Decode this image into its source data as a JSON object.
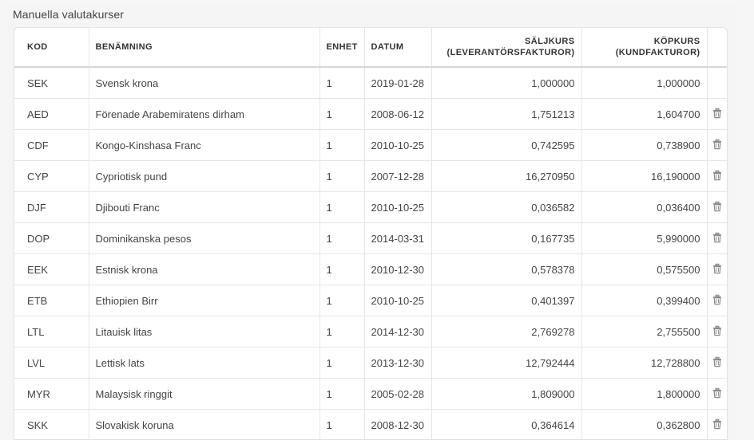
{
  "panel": {
    "title": "Manuella valutakurser"
  },
  "table": {
    "headers": {
      "code": "KOD",
      "name": "BENÄMNING",
      "unit": "ENHET",
      "date": "DATUM",
      "sell_line1": "SÄLJKURS",
      "sell_line2": "(LEVERANTÖRSFAKTUROR)",
      "buy_line1": "KÖPKURS",
      "buy_line2": "(KUNDFAKTUROR)"
    },
    "rows": [
      {
        "code": "SEK",
        "name": "Svensk krona",
        "unit": "1",
        "date": "2019-01-28",
        "sell": "1,000000",
        "buy": "1,000000",
        "deletable": false
      },
      {
        "code": "AED",
        "name": "Förenade Arabemiratens dirham",
        "unit": "1",
        "date": "2008-06-12",
        "sell": "1,751213",
        "buy": "1,604700",
        "deletable": true
      },
      {
        "code": "CDF",
        "name": "Kongo-Kinshasa Franc",
        "unit": "1",
        "date": "2010-10-25",
        "sell": "0,742595",
        "buy": "0,738900",
        "deletable": true
      },
      {
        "code": "CYP",
        "name": "Cypriotisk pund",
        "unit": "1",
        "date": "2007-12-28",
        "sell": "16,270950",
        "buy": "16,190000",
        "deletable": true
      },
      {
        "code": "DJF",
        "name": "Djibouti Franc",
        "unit": "1",
        "date": "2010-10-25",
        "sell": "0,036582",
        "buy": "0,036400",
        "deletable": true
      },
      {
        "code": "DOP",
        "name": "Dominikanska pesos",
        "unit": "1",
        "date": "2014-03-31",
        "sell": "0,167735",
        "buy": "5,990000",
        "deletable": true
      },
      {
        "code": "EEK",
        "name": "Estnisk krona",
        "unit": "1",
        "date": "2010-12-30",
        "sell": "0,578378",
        "buy": "0,575500",
        "deletable": true
      },
      {
        "code": "ETB",
        "name": "Ethiopien Birr",
        "unit": "1",
        "date": "2010-10-25",
        "sell": "0,401397",
        "buy": "0,399400",
        "deletable": true
      },
      {
        "code": "LTL",
        "name": "Litauisk litas",
        "unit": "1",
        "date": "2014-12-30",
        "sell": "2,769278",
        "buy": "2,755500",
        "deletable": true
      },
      {
        "code": "LVL",
        "name": "Lettisk lats",
        "unit": "1",
        "date": "2013-12-30",
        "sell": "12,792444",
        "buy": "12,728800",
        "deletable": true
      },
      {
        "code": "MYR",
        "name": "Malaysisk ringgit",
        "unit": "1",
        "date": "2005-02-28",
        "sell": "1,809000",
        "buy": "1,800000",
        "deletable": true
      },
      {
        "code": "SKK",
        "name": "Slovakisk koruna",
        "unit": "1",
        "date": "2008-12-30",
        "sell": "0,364614",
        "buy": "0,362800",
        "deletable": true
      }
    ]
  },
  "icons": {
    "delete": "trash-icon"
  },
  "colors": {
    "icon": "#8a8a8a",
    "border": "#e6e6e6",
    "header_border": "#d6d6d6"
  }
}
